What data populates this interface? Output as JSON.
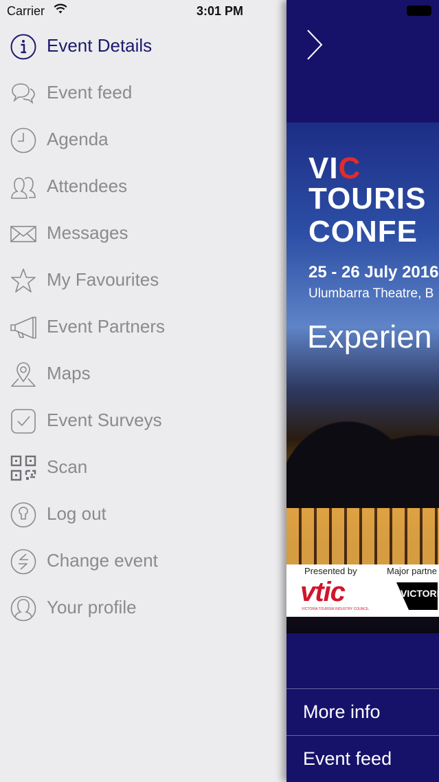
{
  "status": {
    "carrier": "Carrier",
    "time": "3:01 PM"
  },
  "menu": {
    "items": [
      {
        "label": "Event Details",
        "icon": "info-icon"
      },
      {
        "label": "Event feed",
        "icon": "chat-bubbles-icon"
      },
      {
        "label": "Agenda",
        "icon": "clock-icon"
      },
      {
        "label": "Attendees",
        "icon": "people-icon"
      },
      {
        "label": "Messages",
        "icon": "envelope-icon"
      },
      {
        "label": "My Favourites",
        "icon": "star-icon"
      },
      {
        "label": "Event Partners",
        "icon": "megaphone-icon"
      },
      {
        "label": "Maps",
        "icon": "map-pin-icon"
      },
      {
        "label": "Event Surveys",
        "icon": "checkbox-icon"
      },
      {
        "label": "Scan",
        "icon": "qr-code-icon"
      },
      {
        "label": "Log out",
        "icon": "keyhole-icon"
      },
      {
        "label": "Change event",
        "icon": "swap-arrows-icon"
      },
      {
        "label": "Your profile",
        "icon": "user-icon"
      }
    ],
    "active_index": 0,
    "active_color": "#1c1a6b",
    "inactive_color": "#8a8a8f"
  },
  "panel": {
    "background": "#16126a",
    "banner": {
      "logo_vi": "VI",
      "logo_c": "C",
      "title_line1": "TOURIS",
      "title_line2": "CONFE",
      "date": "25 - 26 July 2016",
      "venue": "Ulumbarra Theatre, B",
      "tagline": "Experien",
      "presented_by": "Presented by",
      "major_partner": "Major partne",
      "vtic_logo": "vtic",
      "vtic_subtitle": "VICTORIA TOURISM INDUSTRY COUNCIL",
      "victoria_logo": "VICTORI"
    },
    "links": [
      {
        "label": "More info"
      },
      {
        "label": "Event feed"
      }
    ]
  }
}
